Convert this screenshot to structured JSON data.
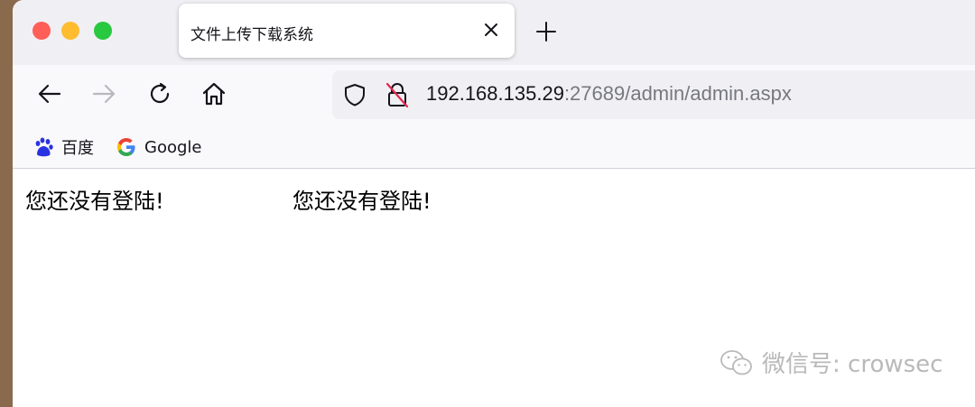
{
  "tab": {
    "title": "文件上传下载系统"
  },
  "url": {
    "host": "192.168.135.29",
    "rest": ":27689/admin/admin.aspx"
  },
  "bookmarks": [
    {
      "label": "百度"
    },
    {
      "label": "Google"
    }
  ],
  "content": {
    "messages": [
      "您还没有登陆!",
      "您还没有登陆!"
    ]
  },
  "watermark": {
    "text": "微信号: crowsec"
  },
  "colors": {
    "accent_red": "#ff5f57",
    "accent_yellow": "#febc2e",
    "accent_green": "#28c840",
    "baidu_blue": "#2932e1"
  }
}
